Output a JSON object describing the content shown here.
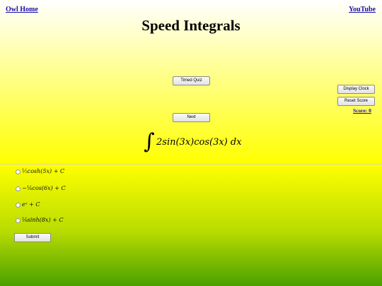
{
  "nav": {
    "home_link": "Owl Home",
    "youtube_link": "YouTube"
  },
  "page": {
    "title": "Speed Integrals"
  },
  "controls": {
    "timed_quiz": "Timed Quiz",
    "display_clock": "Display Clock",
    "reset_score": "Reset Score",
    "score_label": "Score: 0",
    "next": "Next",
    "submit": "Submit"
  },
  "problem": {
    "integral_sign": "∫",
    "integrand": "2sin(3x)cos(3x) dx"
  },
  "options": [
    {
      "label": "⅕cosh(5x) + C"
    },
    {
      "label": "−⅙cos(6x) + C"
    },
    {
      "label": "eˣ + C"
    },
    {
      "label": "⅛sinh(8x) + C"
    }
  ],
  "colors": {
    "link": "#1a0dab",
    "top_gradient_end": "#ffff00",
    "bottom_gradient_end": "#4aa000"
  }
}
